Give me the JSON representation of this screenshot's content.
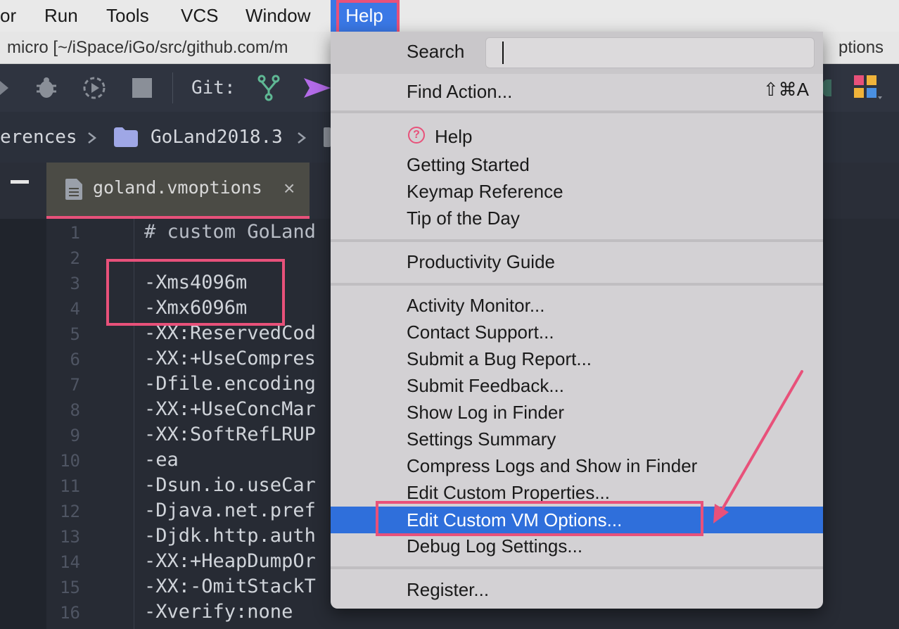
{
  "menubar": {
    "items": [
      {
        "label": "or"
      },
      {
        "label": "Run"
      },
      {
        "label": "Tools"
      },
      {
        "label": "VCS"
      },
      {
        "label": "Window"
      },
      {
        "label": "Help"
      }
    ]
  },
  "titlebar": {
    "left_text": "micro [~/iSpace/iGo/src/github.com/m",
    "right_text": "ptions"
  },
  "toolbar": {
    "git_label": "Git:"
  },
  "breadcrumb": {
    "items": [
      {
        "label": "erences"
      },
      {
        "label": "GoLand2018.3"
      }
    ]
  },
  "tab": {
    "label": "goland.vmoptions",
    "close": "×"
  },
  "editor": {
    "line_numbers": [
      "1",
      "2",
      "3",
      "4",
      "5",
      "6",
      "7",
      "8",
      "9",
      "10",
      "11",
      "12",
      "13",
      "14",
      "15",
      "16"
    ],
    "lines": [
      "# custom GoLand",
      "",
      "-Xms4096m",
      "-Xmx6096m",
      "-XX:ReservedCod",
      "-XX:+UseCompres",
      "-Dfile.encoding",
      "-XX:+UseConcMar",
      "-XX:SoftRefLRUP",
      "-ea",
      "-Dsun.io.useCar",
      "-Djava.net.pref",
      "-Djdk.http.auth",
      "-XX:+HeapDumpOr",
      "-XX:-OmitStackT",
      "-Xverify:none"
    ]
  },
  "help_menu": {
    "search_label": "Search",
    "search_value": "",
    "find_action": {
      "label": "Find Action...",
      "shortcut": "⇧⌘A"
    },
    "group1": [
      "Help",
      "Getting Started",
      "Keymap Reference",
      "Tip of the Day"
    ],
    "group2": [
      "Productivity Guide"
    ],
    "group3": [
      "Activity Monitor...",
      "Contact Support...",
      "Submit a Bug Report...",
      "Submit Feedback...",
      "Show Log in Finder",
      "Settings Summary",
      "Compress Logs and Show in Finder",
      "Edit Custom Properties...",
      "Edit Custom VM Options...",
      "Debug Log Settings..."
    ],
    "group4": [
      "Register..."
    ],
    "selected_item": "Edit Custom VM Options..."
  },
  "colors": {
    "accent": "#3a78e6",
    "selection": "#2f6fdb",
    "annotation": "#e8517a"
  }
}
